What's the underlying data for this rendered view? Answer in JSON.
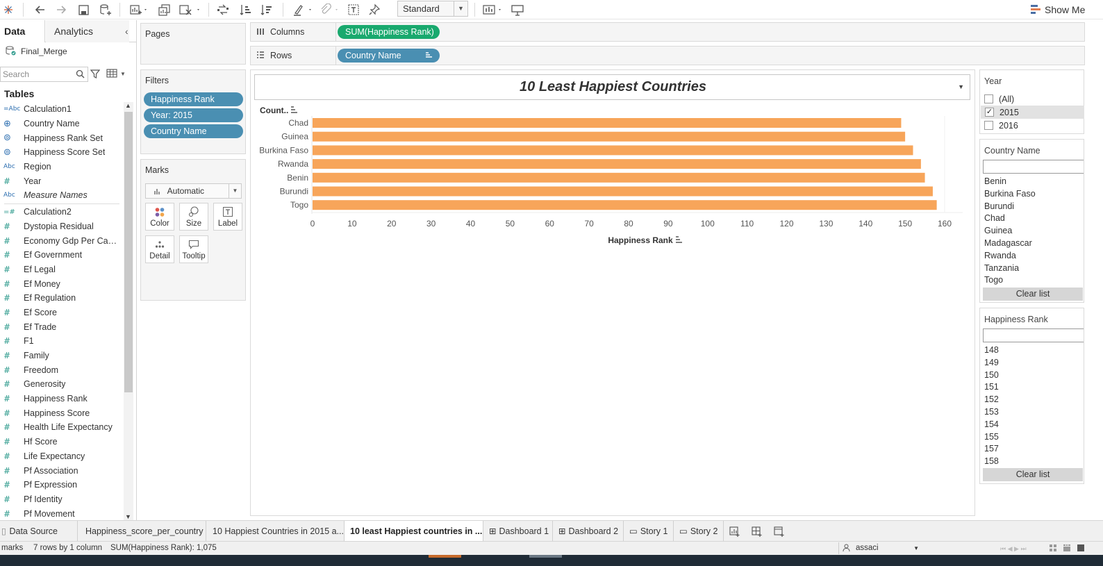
{
  "toolbar": {
    "view_mode": "Standard",
    "show_me_label": "Show Me",
    "icons": [
      "tableau-logo-icon",
      "undo-icon",
      "redo-icon",
      "save-icon",
      "new-datasource-icon",
      "new-worksheet-icon",
      "duplicate-icon",
      "clear-sheet-icon",
      "swap-icon",
      "sort-ascending-icon",
      "sort-descending-icon",
      "highlight-icon",
      "group-icon",
      "label-icon",
      "pin-icon",
      "show-cards-icon",
      "presentation-icon"
    ]
  },
  "data_pane": {
    "tab_data": "Data",
    "tab_analytics": "Analytics",
    "datasource": "Final_Merge",
    "search_placeholder": "Search",
    "tables_title": "Tables",
    "dimensions": [
      {
        "type": "=Abc",
        "name": "Calculation1"
      },
      {
        "type": "globe",
        "name": "Country Name"
      },
      {
        "type": "set",
        "name": "Happiness Rank Set"
      },
      {
        "type": "set",
        "name": "Happiness Score Set"
      },
      {
        "type": "Abc",
        "name": "Region"
      },
      {
        "type": "#",
        "name": "Year"
      },
      {
        "type": "Abc",
        "name": "Measure Names"
      }
    ],
    "measures": [
      {
        "type": "=#",
        "name": "Calculation2"
      },
      {
        "type": "#",
        "name": "Dystopia Residual"
      },
      {
        "type": "#",
        "name": "Economy Gdp Per Capi..."
      },
      {
        "type": "#",
        "name": "Ef Government"
      },
      {
        "type": "#",
        "name": "Ef Legal"
      },
      {
        "type": "#",
        "name": "Ef Money"
      },
      {
        "type": "#",
        "name": "Ef Regulation"
      },
      {
        "type": "#",
        "name": "Ef Score"
      },
      {
        "type": "#",
        "name": "Ef Trade"
      },
      {
        "type": "#",
        "name": "F1"
      },
      {
        "type": "#",
        "name": "Family"
      },
      {
        "type": "#",
        "name": "Freedom"
      },
      {
        "type": "#",
        "name": "Generosity"
      },
      {
        "type": "#",
        "name": "Happiness Rank"
      },
      {
        "type": "#",
        "name": "Happiness Score"
      },
      {
        "type": "#",
        "name": "Health Life Expectancy"
      },
      {
        "type": "#",
        "name": "Hf Score"
      },
      {
        "type": "#",
        "name": "Life Expectancy"
      },
      {
        "type": "#",
        "name": "Pf Association"
      },
      {
        "type": "#",
        "name": "Pf Expression"
      },
      {
        "type": "#",
        "name": "Pf Identity"
      },
      {
        "type": "#",
        "name": "Pf Movement"
      }
    ]
  },
  "cards": {
    "pages_title": "Pages",
    "filters_title": "Filters",
    "filters": [
      "Happiness Rank",
      "Year: 2015",
      "Country Name"
    ],
    "marks_title": "Marks",
    "marks_type": "Automatic",
    "mark_buttons": [
      "Color",
      "Size",
      "Label",
      "Detail",
      "Tooltip"
    ]
  },
  "shelves": {
    "columns_label": "Columns",
    "columns_pill": "SUM(Happiness Rank)",
    "rows_label": "Rows",
    "rows_pill": "Country Name"
  },
  "colors": {
    "bar": "#f7a55a",
    "measure_pill": "#19a96e",
    "dimension_pill": "#4a8fb2"
  },
  "viz": {
    "title": "10 Least Happiest Countries",
    "row_header": "Count..",
    "x_axis_title": "Happiness Rank"
  },
  "chart_data": {
    "type": "bar",
    "orientation": "horizontal",
    "title": "10 Least Happiest Countries",
    "categories": [
      "Chad",
      "Guinea",
      "Burkina Faso",
      "Rwanda",
      "Benin",
      "Burundi",
      "Togo"
    ],
    "values": [
      149,
      150,
      152,
      154,
      155,
      157,
      158
    ],
    "xlabel": "Happiness Rank",
    "ylabel": "Count..",
    "xlim": [
      0,
      160
    ],
    "x_ticks": [
      0,
      10,
      20,
      30,
      40,
      50,
      60,
      70,
      80,
      90,
      100,
      110,
      120,
      130,
      140,
      150,
      160
    ],
    "grid": false
  },
  "right_filters": {
    "year": {
      "title": "Year",
      "options": [
        {
          "label": "(All)",
          "checked": false
        },
        {
          "label": "2015",
          "checked": true
        },
        {
          "label": "2016",
          "checked": false
        }
      ]
    },
    "country": {
      "title": "Country Name",
      "items": [
        "Benin",
        "Burkina Faso",
        "Burundi",
        "Chad",
        "Guinea",
        "Madagascar",
        "Rwanda",
        "Tanzania",
        "Togo"
      ],
      "clear_label": "Clear list"
    },
    "rank": {
      "title": "Happiness Rank",
      "items": [
        "148",
        "149",
        "150",
        "151",
        "152",
        "153",
        "154",
        "155",
        "157",
        "158"
      ],
      "clear_label": "Clear list"
    }
  },
  "sheet_tabs": {
    "data_source": "Data Source",
    "tabs": [
      "Happiness_score_per_country",
      "10 Happiest Countries in 2015 a...",
      "10 least Happiest countries in ...",
      "Dashboard 1",
      "Dashboard 2",
      "Story 1",
      "Story 2"
    ]
  },
  "status": {
    "marks": "marks",
    "rows_cols": "7 rows by 1 column",
    "sum": "SUM(Happiness Rank): 1,075",
    "user": "assaci"
  }
}
